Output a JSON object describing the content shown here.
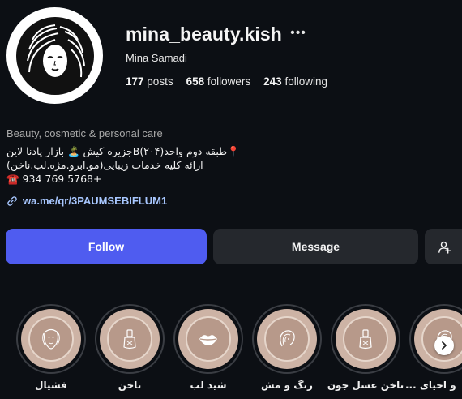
{
  "profile": {
    "username": "mina_beauty.kish",
    "full_name": "Mina Samadi",
    "more_icon": "ellipsis-icon",
    "avatar_icon": "woman-face-logo"
  },
  "stats": {
    "posts_count": "177",
    "posts_label": "posts",
    "followers_count": "658",
    "followers_label": "followers",
    "following_count": "243",
    "following_label": "following"
  },
  "bio": {
    "category": "Beauty, cosmetic & personal care",
    "line1": "📍طبقه دوم واحد(۲۰۴)Bجزیره کیش 🏝️ بازار پادنا لاین",
    "line2": "ارائه کلیه خدمات زیبایی(مو.ابرو.مژه.لب.ناخن)",
    "line3": "☎️ 934 769 5768+"
  },
  "link": {
    "text": "wa.me/qr/3PAUMSEBIFLUM1",
    "icon": "link-icon"
  },
  "actions": {
    "follow_label": "Follow",
    "message_label": "Message",
    "add_user_icon": "person-plus-icon"
  },
  "highlights": [
    {
      "label": "فشیال",
      "icon": "face-icon"
    },
    {
      "label": "ناخن",
      "icon": "nail-polish-icon"
    },
    {
      "label": "شید لب",
      "icon": "lips-icon"
    },
    {
      "label": "رنگ و مش",
      "icon": "hair-icon"
    },
    {
      "label": "ناخن عسل جون",
      "icon": "nail-polish-icon"
    },
    {
      "label": "... و احیای",
      "icon": "hair-icon"
    }
  ],
  "colors": {
    "background": "#0c0f14",
    "follow_button": "#4f5cf0",
    "secondary_button": "#25282d",
    "link": "#a8c7ff",
    "highlight_fill": "#cdb3a5"
  }
}
